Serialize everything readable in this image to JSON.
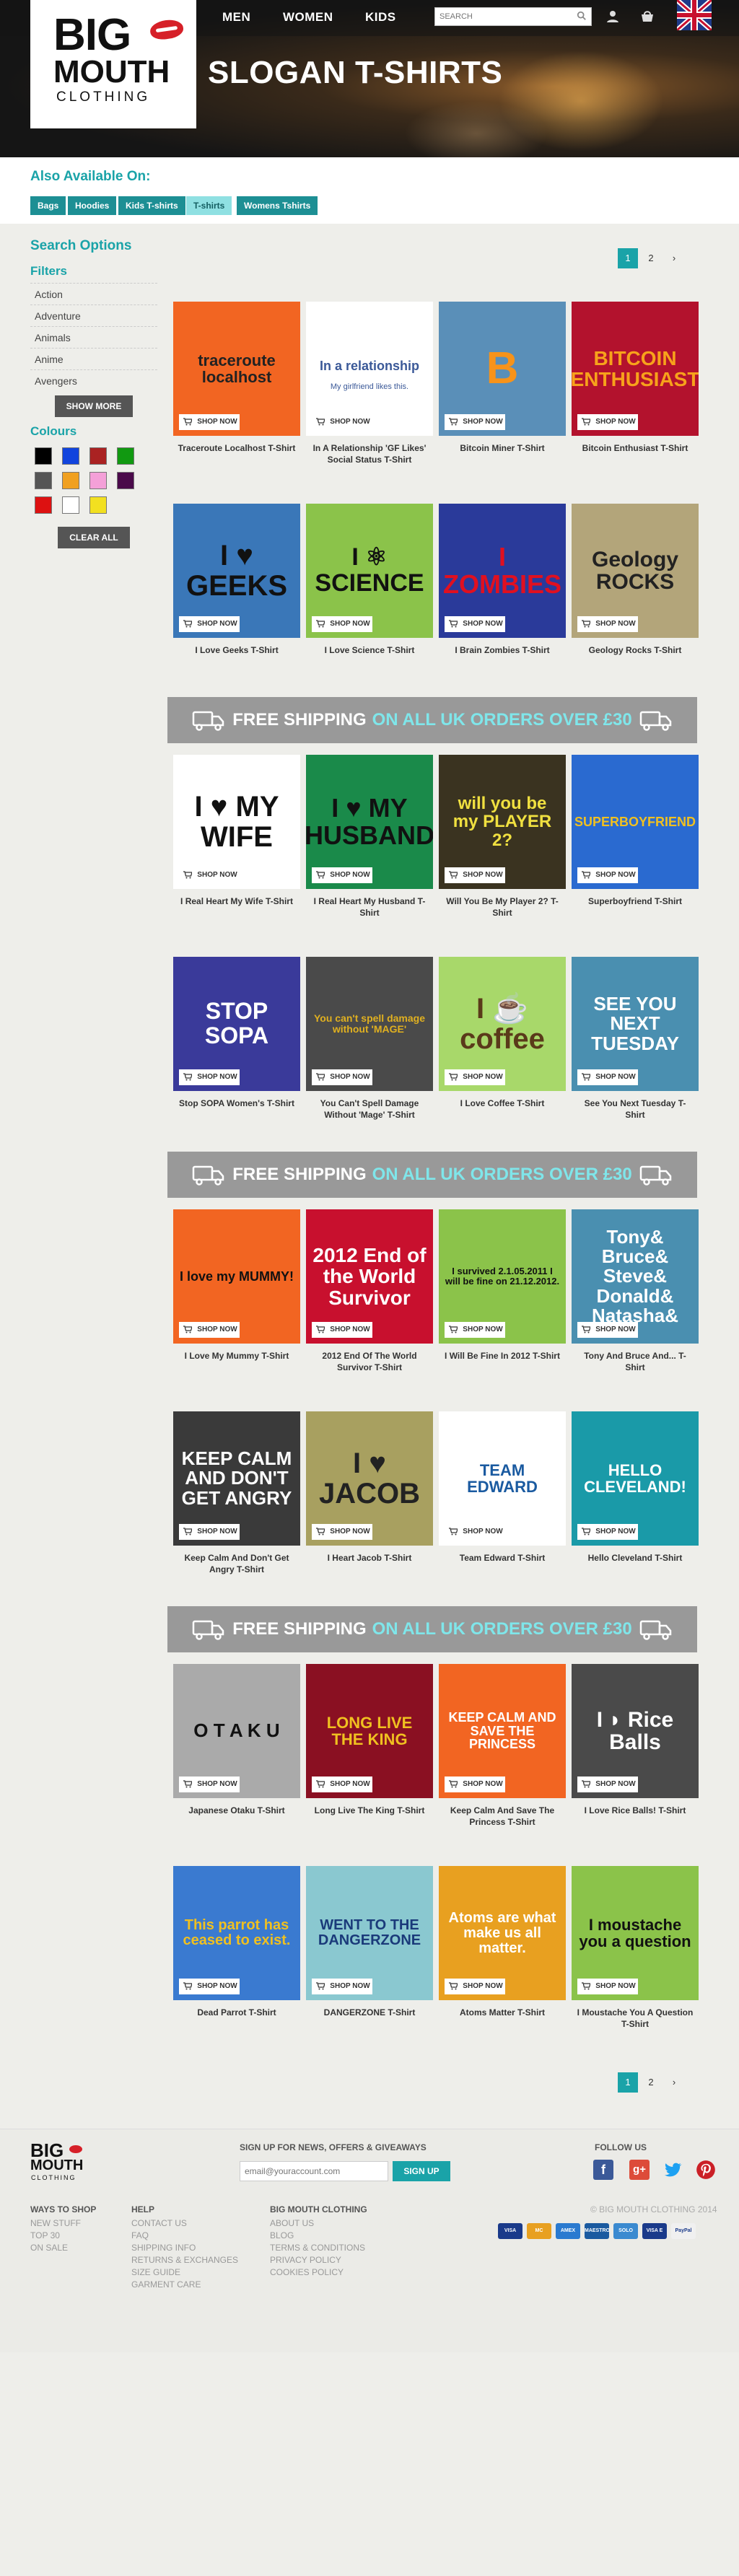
{
  "header": {
    "logo": {
      "line1": "BIG",
      "line2": "MOUTH",
      "line3": "CLOTHING"
    },
    "nav": [
      "MEN",
      "WOMEN",
      "KIDS"
    ],
    "search_placeholder": "SEARCH",
    "title": "SLOGAN T-SHIRTS"
  },
  "also_available": {
    "heading": "Also Available On:",
    "chips": [
      "Bags",
      "Hoodies",
      "Kids T-shirts",
      "T-shirts",
      "Womens Tshirts"
    ],
    "active": "T-shirts"
  },
  "sidebar": {
    "heading": "Search Options",
    "filters_heading": "Filters",
    "filters": [
      "Action",
      "Adventure",
      "Animals",
      "Anime",
      "Avengers"
    ],
    "show_more": "SHOW MORE",
    "colours_heading": "Colours",
    "colours": [
      "#000000",
      "#1144dd",
      "#aa2222",
      "#119911",
      "#555555",
      "#f0a020",
      "#f4a0d8",
      "#4a0a4a",
      "#dd1111",
      "#ffffff",
      "#f2e020"
    ],
    "clear_all": "CLEAR ALL"
  },
  "pager": {
    "pages": [
      "1",
      "2"
    ],
    "current": "1",
    "next": "›"
  },
  "shop_label": "SHOP NOW",
  "shipping_banner": {
    "text": "FREE SHIPPING",
    "highlight": "ON ALL UK ORDERS OVER £30"
  },
  "products": [
    {
      "title": "Traceroute Localhost T-Shirt",
      "bg": "#f26522",
      "art": "traceroute localhost",
      "fg": "#222"
    },
    {
      "title": "In A Relationship 'GF Likes' Social Status T-Shirt",
      "bg": "#ffffff",
      "art": "In a relationship",
      "art2": "My girlfriend likes this.",
      "fg": "#3b5998"
    },
    {
      "title": "Bitcoin Miner T-Shirt",
      "bg": "#5a8fb8",
      "art": "B",
      "fg": "#f7931a"
    },
    {
      "title": "Bitcoin Enthusiast T-Shirt",
      "bg": "#b3122d",
      "art": "BITCOIN ENTHUSIAST",
      "fg": "#f7a21b"
    },
    {
      "title": "I Love Geeks T-Shirt",
      "bg": "#3a77b8",
      "art": "I ♥ GEEKS",
      "fg": "#111"
    },
    {
      "title": "I Love Science T-Shirt",
      "bg": "#8bc34a",
      "art": "I ⚛ SCIENCE",
      "fg": "#111"
    },
    {
      "title": "I Brain Zombies T-Shirt",
      "bg": "#2a3a9a",
      "art": "I ZOMBIES",
      "fg": "#e01020"
    },
    {
      "title": "Geology Rocks T-Shirt",
      "bg": "#b3a57a",
      "art": "Geology ROCKS",
      "fg": "#222"
    },
    {
      "title": "I Real Heart My Wife T-Shirt",
      "bg": "#ffffff",
      "art": "I ♥ MY WIFE",
      "fg": "#111"
    },
    {
      "title": "I Real Heart My Husband T-Shirt",
      "bg": "#1a8a4a",
      "art": "I ♥ MY HUSBAND",
      "fg": "#111"
    },
    {
      "title": "Will You Be My Player 2? T-Shirt",
      "bg": "#3a3320",
      "art": "will you be my PLAYER 2?",
      "fg": "#f0e040"
    },
    {
      "title": "Superboyfriend T-Shirt",
      "bg": "#2a6ad0",
      "art": "SUPERBOYFRIEND",
      "fg": "#f0c020"
    },
    {
      "title": "Stop SOPA Women's T-Shirt",
      "bg": "#3a3a9a",
      "art": "STOP SOPA",
      "fg": "#ffffff"
    },
    {
      "title": "You Can't Spell Damage Without 'Mage' T-Shirt",
      "bg": "#4a4a4a",
      "art": "You can't spell damage without 'MAGE'",
      "fg": "#e0b020"
    },
    {
      "title": "I Love Coffee T-Shirt",
      "bg": "#a8d86a",
      "art": "I ☕ coffee",
      "fg": "#5a3a1a"
    },
    {
      "title": "See You Next Tuesday T-Shirt",
      "bg": "#4a8fb0",
      "art": "SEE YOU NEXT TUESDAY",
      "fg": "#ffffff"
    },
    {
      "title": "I Love My Mummy T-Shirt",
      "bg": "#f26522",
      "art": "I love my MUMMY!",
      "fg": "#111"
    },
    {
      "title": "2012 End Of The World Survivor T-Shirt",
      "bg": "#c8102e",
      "art": "2012 End of the World Survivor",
      "fg": "#ffffff"
    },
    {
      "title": "I Will Be Fine In 2012 T-Shirt",
      "bg": "#8bc34a",
      "art": "I survived 2.1.05.2011 I will be fine on 21.12.2012.",
      "fg": "#111"
    },
    {
      "title": "Tony And Bruce And... T-Shirt",
      "bg": "#4a8fb0",
      "art": "Tony& Bruce& Steve& Donald& Natasha&",
      "fg": "#ffffff"
    },
    {
      "title": "Keep Calm And Don't Get Angry T-Shirt",
      "bg": "#3a3a3a",
      "art": "KEEP CALM AND DON'T GET ANGRY",
      "fg": "#ffffff"
    },
    {
      "title": "I Heart Jacob T-Shirt",
      "bg": "#a8a060",
      "art": "I ♥ JACOB",
      "fg": "#222"
    },
    {
      "title": "Team Edward T-Shirt",
      "bg": "#ffffff",
      "art": "TEAM EDWARD",
      "fg": "#1a5aa0"
    },
    {
      "title": "Hello Cleveland T-Shirt",
      "bg": "#1a9aa8",
      "art": "HELLO CLEVELAND!",
      "fg": "#ffffff"
    },
    {
      "title": "Japanese Otaku T-Shirt",
      "bg": "#aaaaaa",
      "art": "O T A K U",
      "fg": "#111"
    },
    {
      "title": "Long Live The King T-Shirt",
      "bg": "#8a1022",
      "art": "LONG LIVE THE KING",
      "fg": "#f0c020"
    },
    {
      "title": "Keep Calm And Save The Princess T-Shirt",
      "bg": "#f26522",
      "art": "KEEP CALM AND SAVE THE PRINCESS",
      "fg": "#ffffff"
    },
    {
      "title": "I Love Rice Balls! T-Shirt",
      "bg": "#4a4a4a",
      "art": "I ◗ Rice Balls",
      "fg": "#ffffff"
    },
    {
      "title": "Dead Parrot T-Shirt",
      "bg": "#3a7ad0",
      "art": "This parrot has ceased to exist.",
      "fg": "#f0c020"
    },
    {
      "title": "DANGERZONE T-Shirt",
      "bg": "#8ac8d0",
      "art": "WENT TO THE DANGERZONE",
      "fg": "#1a3a7a"
    },
    {
      "title": "Atoms Matter T-Shirt",
      "bg": "#e8a020",
      "art": "Atoms are what make us all matter.",
      "fg": "#ffffff"
    },
    {
      "title": "I Moustache You A Question T-Shirt",
      "bg": "#8bc34a",
      "art": "I moustache you a question",
      "fg": "#111"
    }
  ],
  "footer": {
    "logo": {
      "line1": "BIG",
      "line2": "MOUTH",
      "line3": "CLOTHING"
    },
    "newsletter_heading": "SIGN UP FOR NEWS, OFFERS & GIVEAWAYS",
    "newsletter_placeholder": "email@yourаccount.com",
    "signup": "SIGN UP",
    "follow_heading": "FOLLOW US",
    "columns": [
      {
        "heading": "WAYS TO SHOP",
        "links": [
          "NEW STUFF",
          "TOP 30",
          "ON SALE"
        ]
      },
      {
        "heading": "HELP",
        "links": [
          "CONTACT US",
          "FAQ",
          "SHIPPING INFO",
          "RETURNS & EXCHANGES",
          "SIZE GUIDE",
          "GARMENT CARE"
        ]
      },
      {
        "heading": "BIG MOUTH CLOTHING",
        "links": [
          "ABOUT US",
          "BLOG",
          "TERMS & CONDITIONS",
          "PRIVACY POLICY",
          "COOKIES POLICY"
        ]
      }
    ],
    "copyright": "© BIG MOUTH CLOTHING 2014",
    "payments": [
      "VISA",
      "MC",
      "AMEX",
      "MAESTRO",
      "SOLO",
      "VISA E",
      "PayPal"
    ]
  }
}
